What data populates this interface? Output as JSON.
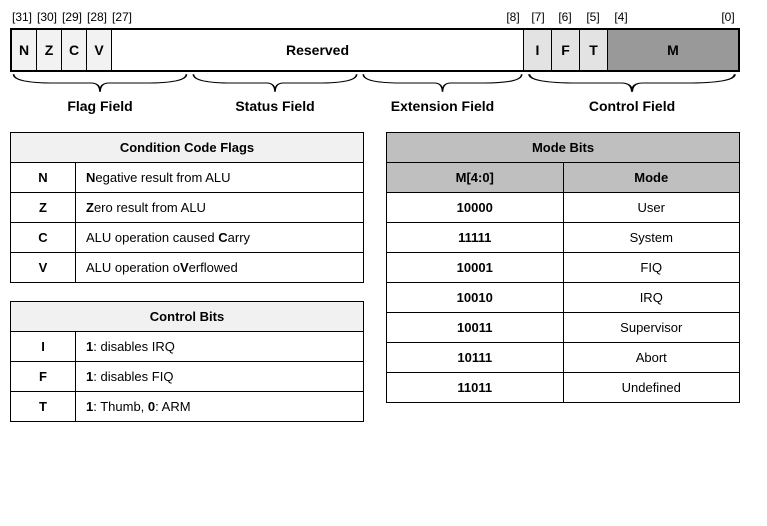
{
  "register": {
    "bit_labels": {
      "b31": "[31]",
      "b30": "[30]",
      "b29": "[29]",
      "b28": "[28]",
      "b27": "[27]",
      "b8": "[8]",
      "b7": "[7]",
      "b6": "[6]",
      "b5": "[5]",
      "b4": "[4]",
      "b0": "[0]"
    },
    "cells": {
      "N": "N",
      "Z": "Z",
      "C": "C",
      "V": "V",
      "Reserved": "Reserved",
      "I": "I",
      "F": "F",
      "T": "T",
      "M": "M"
    },
    "fields": {
      "flag": "Flag Field",
      "status": "Status Field",
      "extension": "Extension Field",
      "control": "Control Field"
    }
  },
  "tables": {
    "cond_flags": {
      "title": "Condition Code Flags",
      "rows": [
        {
          "k": "N",
          "pre": "",
          "b": "N",
          "post": "egative result from ALU"
        },
        {
          "k": "Z",
          "pre": "",
          "b": "Z",
          "post": "ero result from ALU"
        },
        {
          "k": "C",
          "pre": "ALU operation caused ",
          "b": "C",
          "post": "arry"
        },
        {
          "k": "V",
          "pre": "ALU operation o",
          "b": "V",
          "post": "erflowed"
        }
      ]
    },
    "ctrl_bits": {
      "title": "Control Bits",
      "rows": [
        {
          "k": "I",
          "desc": "1: disables IRQ"
        },
        {
          "k": "F",
          "desc": "1: disables FIQ"
        },
        {
          "k": "T",
          "desc": "1: Thumb, 0: ARM"
        }
      ]
    },
    "mode_bits": {
      "title": "Mode Bits",
      "col1": "M[4:0]",
      "col2": "Mode",
      "rows": [
        {
          "bits": "10000",
          "mode": "User"
        },
        {
          "bits": "11111",
          "mode": "System"
        },
        {
          "bits": "10001",
          "mode": "FIQ"
        },
        {
          "bits": "10010",
          "mode": "IRQ"
        },
        {
          "bits": "10011",
          "mode": "Supervisor"
        },
        {
          "bits": "10111",
          "mode": "Abort"
        },
        {
          "bits": "11011",
          "mode": "Undefined"
        }
      ]
    }
  }
}
